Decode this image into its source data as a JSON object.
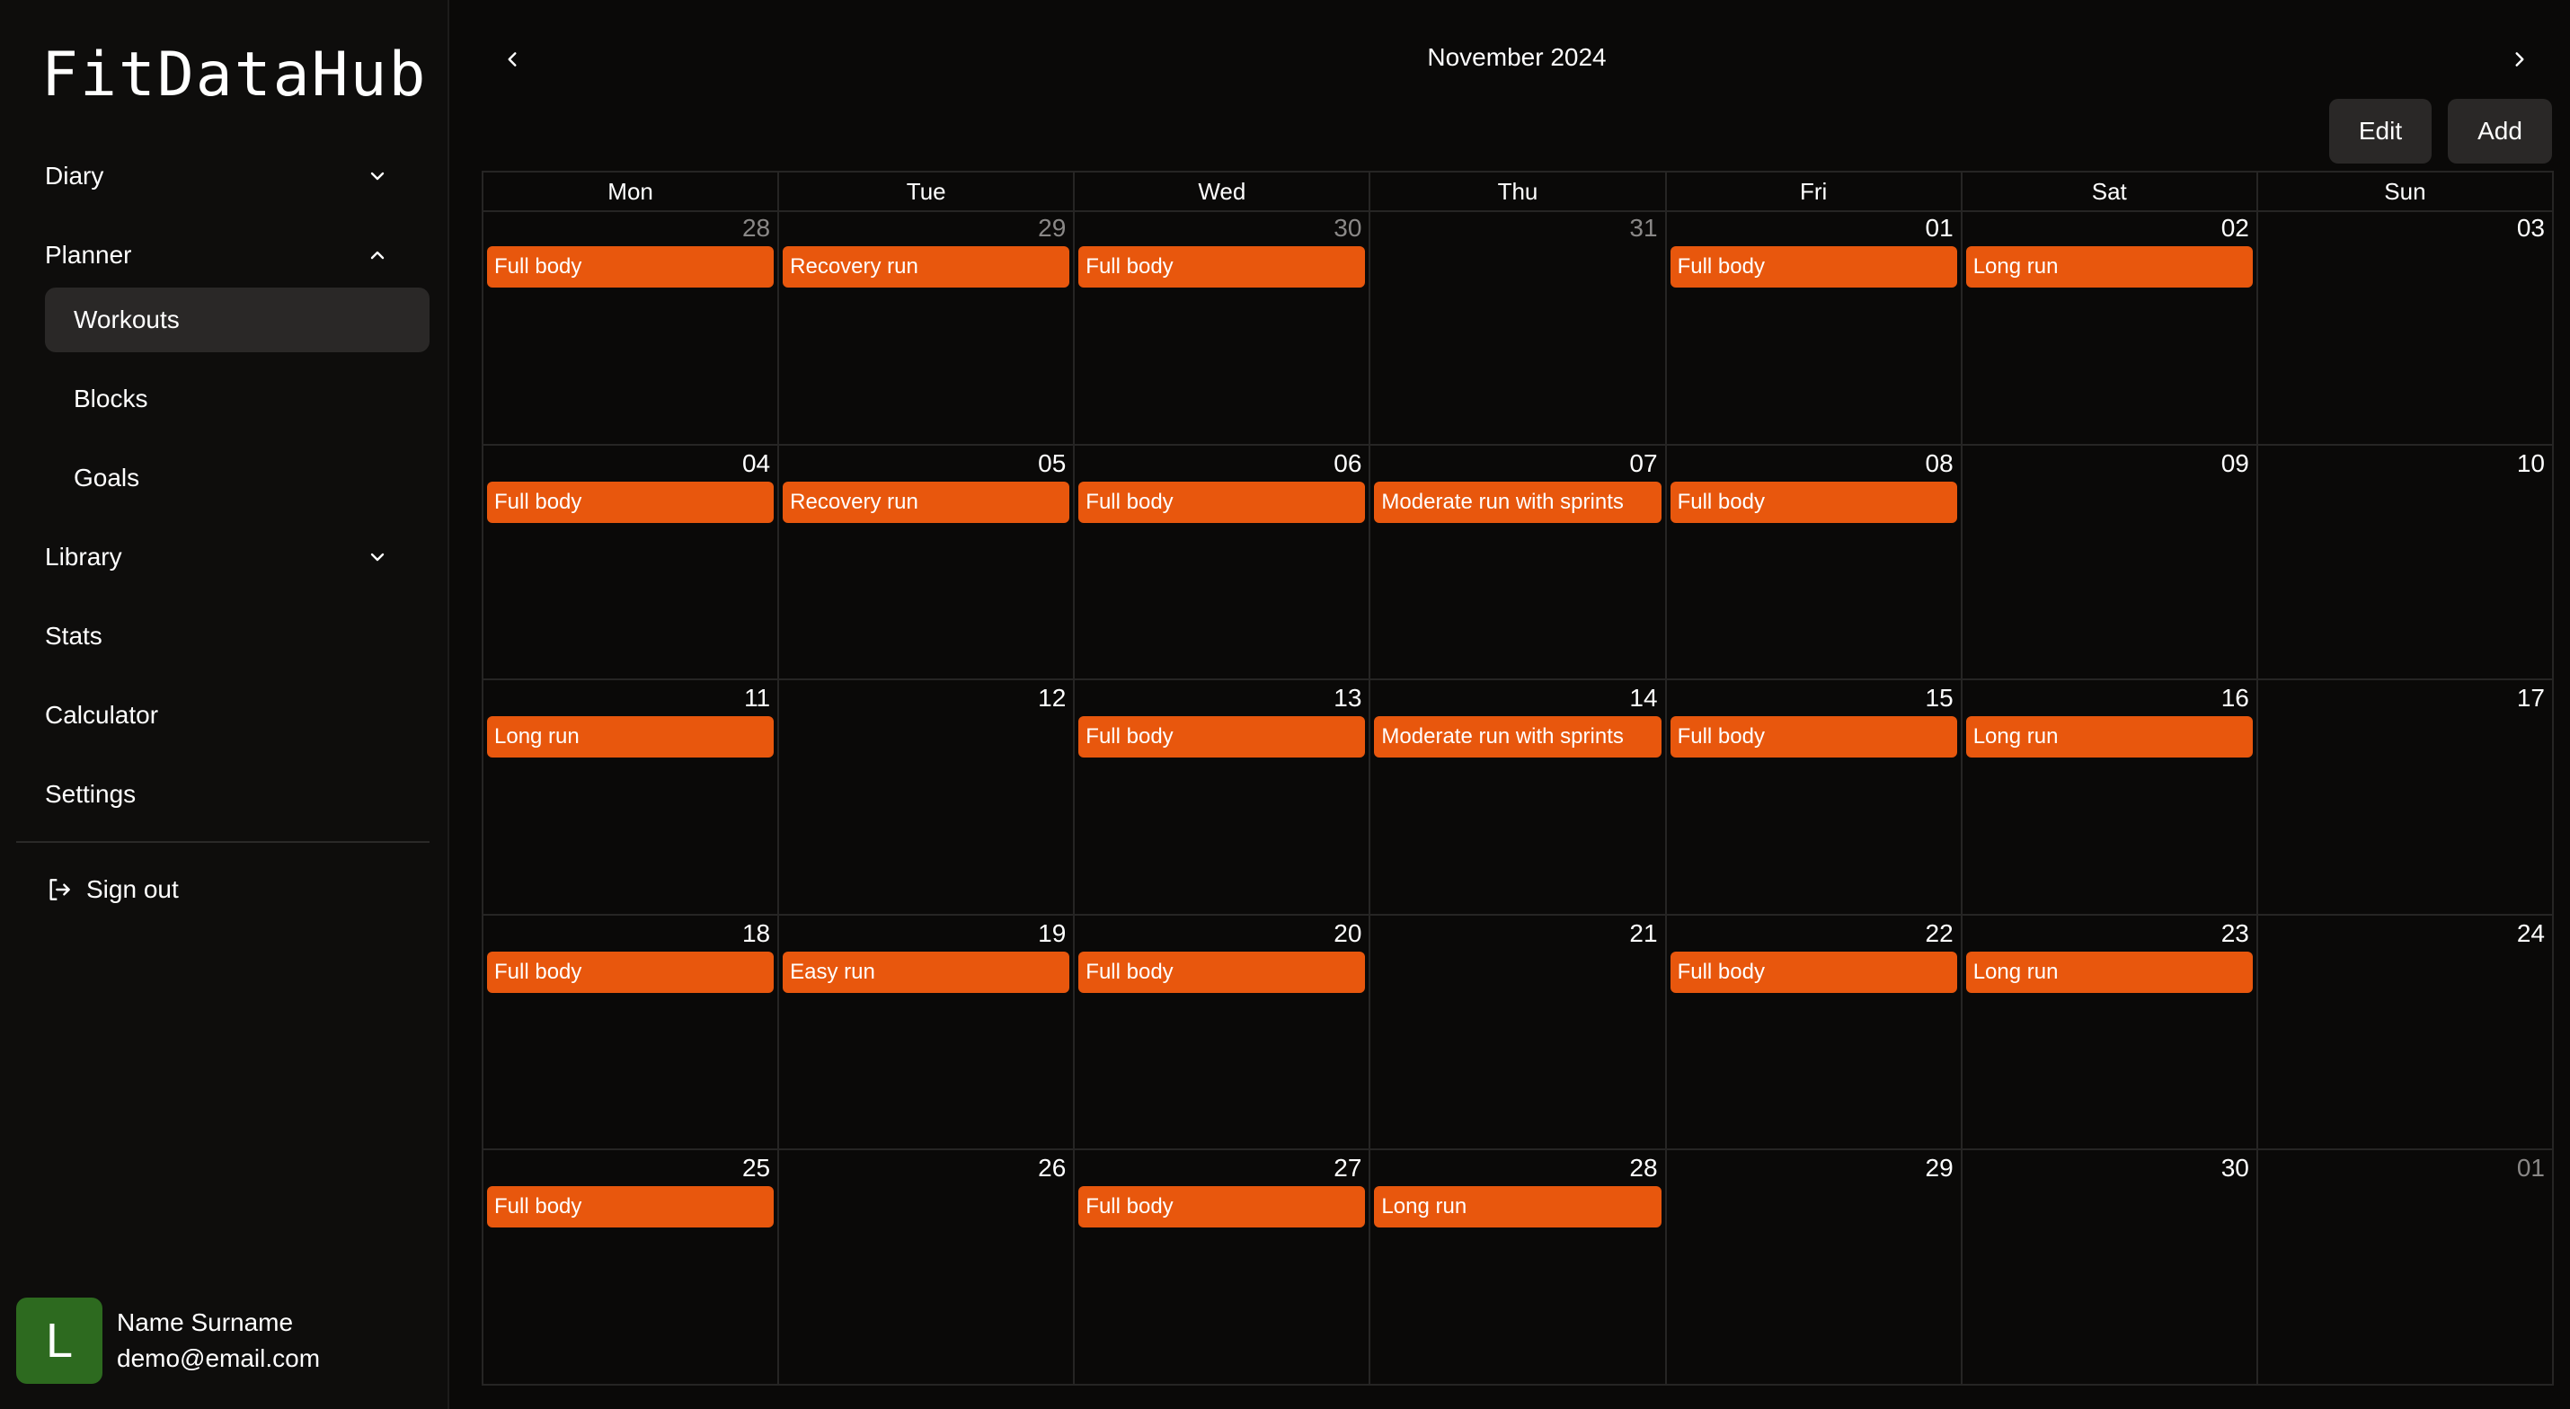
{
  "app": {
    "title": "FitDataHub"
  },
  "sidebar": {
    "items": [
      {
        "label": "Diary"
      },
      {
        "label": "Planner"
      },
      {
        "label": "Library"
      },
      {
        "label": "Stats"
      },
      {
        "label": "Calculator"
      },
      {
        "label": "Settings"
      }
    ],
    "planner_sub": [
      {
        "label": "Workouts",
        "active": true
      },
      {
        "label": "Blocks"
      },
      {
        "label": "Goals"
      }
    ],
    "sign_out": "Sign out"
  },
  "user": {
    "initial": "L",
    "name": "Name Surname",
    "email": "demo@email.com"
  },
  "calendar": {
    "month_title": "November 2024",
    "edit_label": "Edit",
    "add_label": "Add",
    "weekdays": [
      "Mon",
      "Tue",
      "Wed",
      "Thu",
      "Fri",
      "Sat",
      "Sun"
    ],
    "weeks": [
      [
        {
          "day": "28",
          "muted": true,
          "event": "Full body"
        },
        {
          "day": "29",
          "muted": true,
          "event": "Recovery run"
        },
        {
          "day": "30",
          "muted": true,
          "event": "Full body"
        },
        {
          "day": "31",
          "muted": true,
          "event": ""
        },
        {
          "day": "01",
          "muted": false,
          "event": "Full body"
        },
        {
          "day": "02",
          "muted": false,
          "event": "Long run"
        },
        {
          "day": "03",
          "muted": false,
          "event": ""
        }
      ],
      [
        {
          "day": "04",
          "muted": false,
          "event": "Full body"
        },
        {
          "day": "05",
          "muted": false,
          "event": "Recovery run"
        },
        {
          "day": "06",
          "muted": false,
          "event": "Full body"
        },
        {
          "day": "07",
          "muted": false,
          "event": "Moderate run with sprints"
        },
        {
          "day": "08",
          "muted": false,
          "event": "Full body"
        },
        {
          "day": "09",
          "muted": false,
          "event": ""
        },
        {
          "day": "10",
          "muted": false,
          "event": ""
        }
      ],
      [
        {
          "day": "11",
          "muted": false,
          "event": "Long run"
        },
        {
          "day": "12",
          "muted": false,
          "event": ""
        },
        {
          "day": "13",
          "muted": false,
          "event": "Full body"
        },
        {
          "day": "14",
          "muted": false,
          "event": "Moderate run with sprints"
        },
        {
          "day": "15",
          "muted": false,
          "event": "Full body"
        },
        {
          "day": "16",
          "muted": false,
          "event": "Long run"
        },
        {
          "day": "17",
          "muted": false,
          "event": ""
        }
      ],
      [
        {
          "day": "18",
          "muted": false,
          "event": "Full body"
        },
        {
          "day": "19",
          "muted": false,
          "event": "Easy run"
        },
        {
          "day": "20",
          "muted": false,
          "event": "Full body"
        },
        {
          "day": "21",
          "muted": false,
          "event": ""
        },
        {
          "day": "22",
          "muted": false,
          "event": "Full body"
        },
        {
          "day": "23",
          "muted": false,
          "event": "Long run"
        },
        {
          "day": "24",
          "muted": false,
          "event": ""
        }
      ],
      [
        {
          "day": "25",
          "muted": false,
          "event": "Full body"
        },
        {
          "day": "26",
          "muted": false,
          "event": ""
        },
        {
          "day": "27",
          "muted": false,
          "event": "Full body"
        },
        {
          "day": "28",
          "muted": false,
          "event": "Long run"
        },
        {
          "day": "29",
          "muted": false,
          "event": ""
        },
        {
          "day": "30",
          "muted": false,
          "event": ""
        },
        {
          "day": "01",
          "muted": true,
          "event": ""
        }
      ]
    ]
  },
  "colors": {
    "accent": "#e8570d",
    "background": "#0a0908",
    "avatar": "#2d6a1f"
  },
  "icons": {
    "prev": "chevron-left-icon",
    "next": "chevron-right-icon",
    "sign_out": "sign-out-icon"
  }
}
